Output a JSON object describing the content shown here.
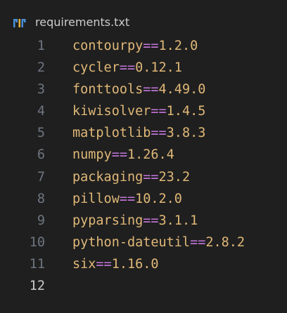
{
  "file": {
    "name": "requirements.txt",
    "icon": "pip-icon"
  },
  "lines": [
    {
      "number": "1",
      "package": "contourpy",
      "op": "==",
      "version": "1.2.0"
    },
    {
      "number": "2",
      "package": "cycler",
      "op": "==",
      "version": "0.12.1"
    },
    {
      "number": "3",
      "package": "fonttools",
      "op": "==",
      "version": "4.49.0"
    },
    {
      "number": "4",
      "package": "kiwisolver",
      "op": "==",
      "version": "1.4.5"
    },
    {
      "number": "5",
      "package": "matplotlib",
      "op": "==",
      "version": "3.8.3"
    },
    {
      "number": "6",
      "package": "numpy",
      "op": "==",
      "version": "1.26.4"
    },
    {
      "number": "7",
      "package": "packaging",
      "op": "==",
      "version": "23.2"
    },
    {
      "number": "8",
      "package": "pillow",
      "op": "==",
      "version": "10.2.0"
    },
    {
      "number": "9",
      "package": "pyparsing",
      "op": "==",
      "version": "3.1.1"
    },
    {
      "number": "10",
      "package": "python-dateutil",
      "op": "==",
      "version": "2.8.2"
    },
    {
      "number": "11",
      "package": "six",
      "op": "==",
      "version": "1.16.0"
    },
    {
      "number": "12",
      "package": "",
      "op": "",
      "version": ""
    }
  ],
  "active_line": "12",
  "colors": {
    "background": "#1f1f1f",
    "line_number": "#6e7681",
    "line_number_active": "#cccccc",
    "package": "#e0b878",
    "operator": "#c678dd",
    "version": "#e0b878"
  }
}
